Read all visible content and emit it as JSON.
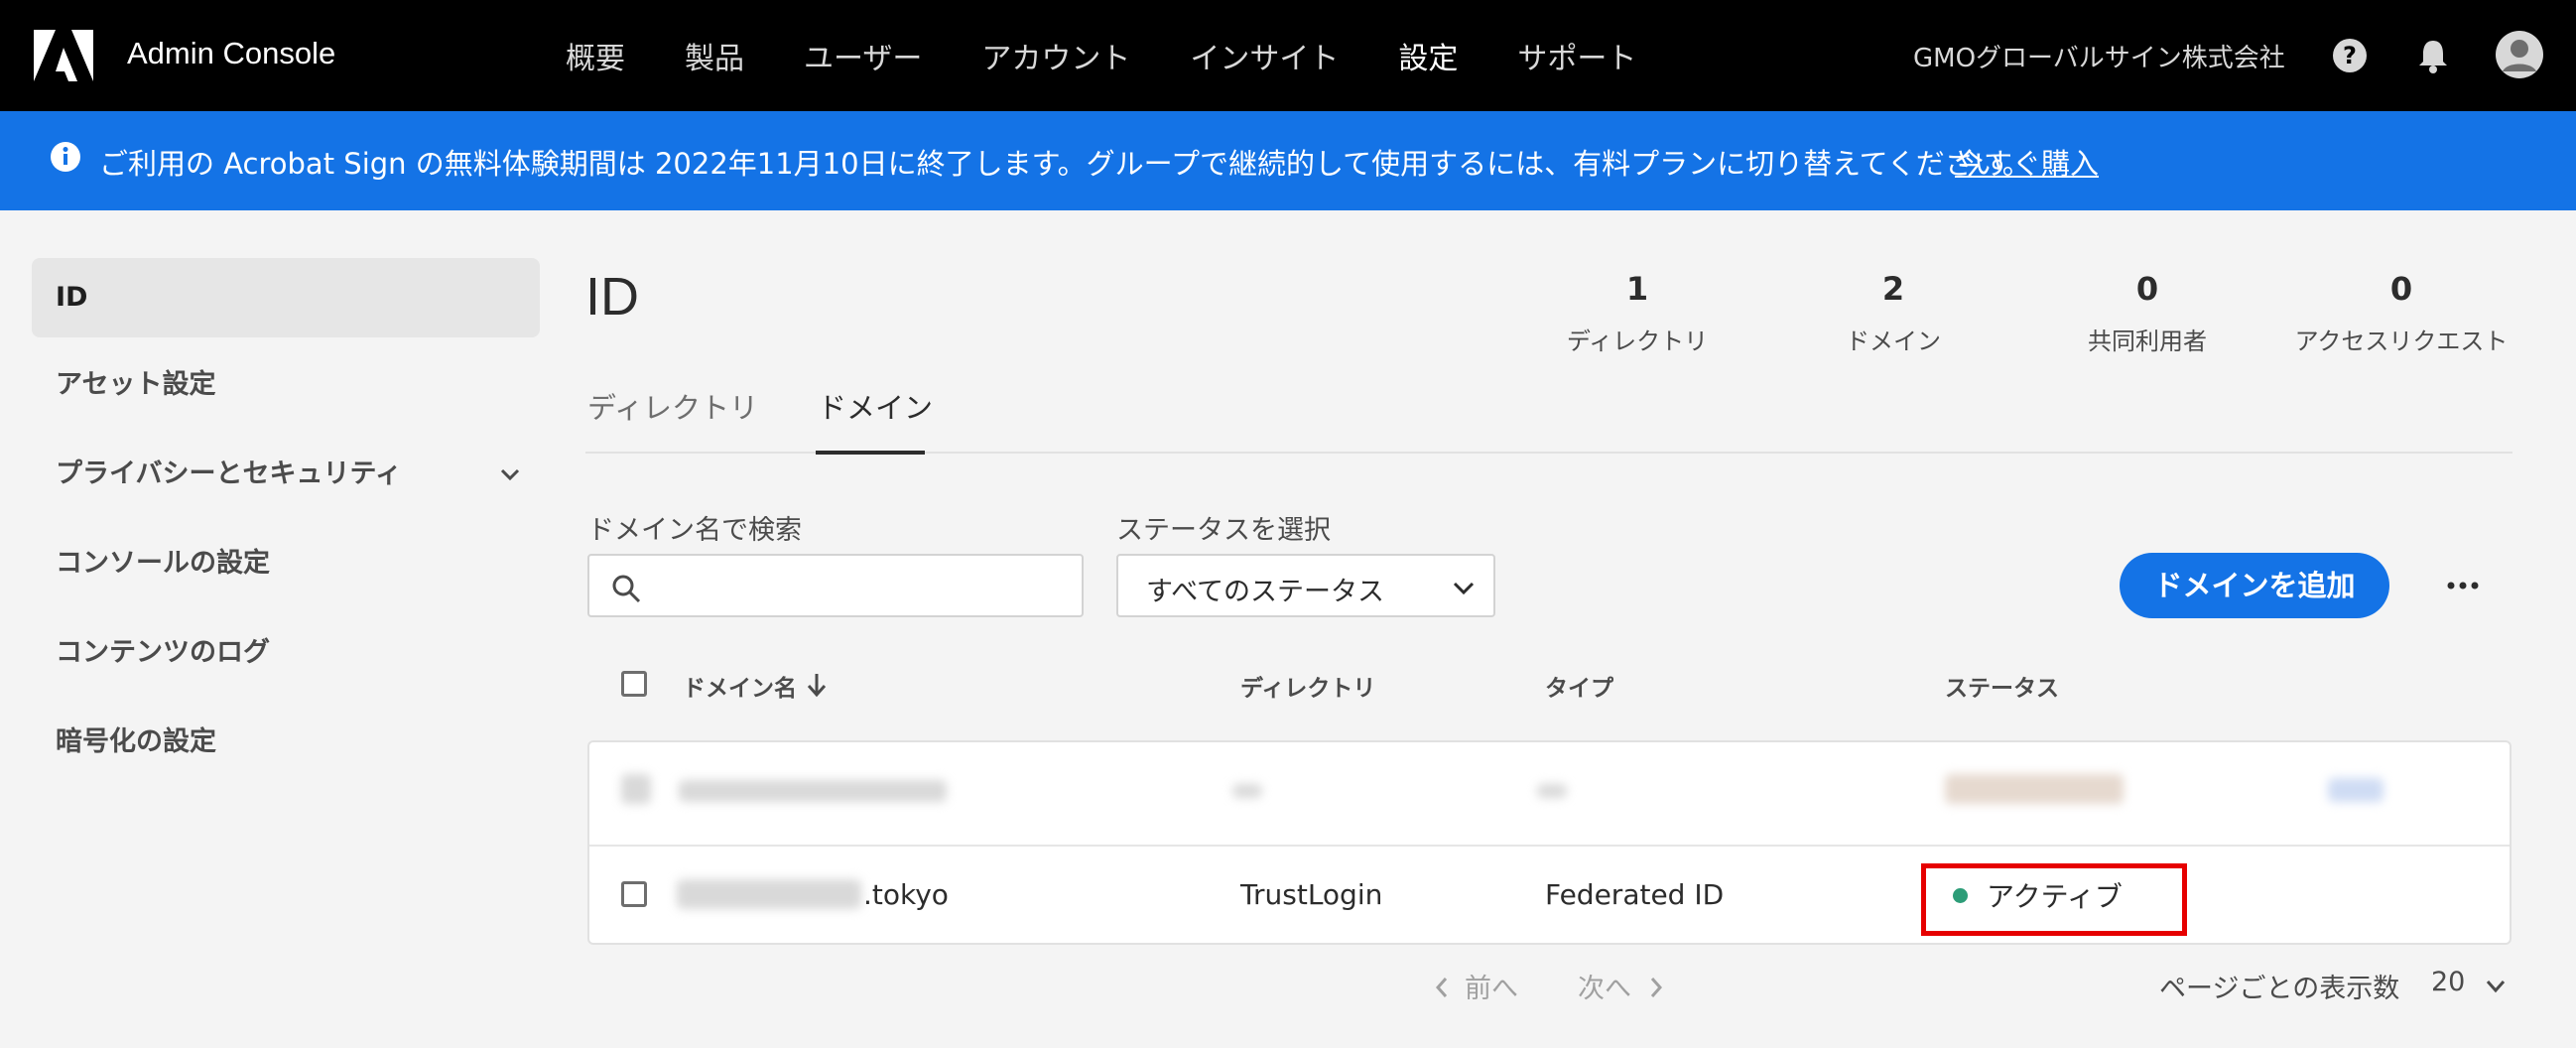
{
  "app": {
    "title": "Admin Console",
    "org": "GMOグローバルサイン株式会社"
  },
  "nav": {
    "items": [
      "概要",
      "製品",
      "ユーザー",
      "アカウント",
      "インサイト",
      "設定",
      "サポート"
    ],
    "active_index": 5
  },
  "banner": {
    "text": "ご利用の Acrobat Sign の無料体験期間は 2022年11月10日に終了します。グループで継続的して使用するには、有料プランに切り替えてください。",
    "link": "今すぐ購入"
  },
  "sidebar": {
    "items": [
      {
        "label": "ID",
        "active": true
      },
      {
        "label": "アセット設定"
      },
      {
        "label": "プライバシーとセキュリティ",
        "expandable": true
      },
      {
        "label": "コンソールの設定"
      },
      {
        "label": "コンテンツのログ"
      },
      {
        "label": "暗号化の設定"
      }
    ]
  },
  "main": {
    "title": "ID",
    "stats": [
      {
        "value": "1",
        "label": "ディレクトリ"
      },
      {
        "value": "2",
        "label": "ドメイン"
      },
      {
        "value": "0",
        "label": "共同利用者"
      },
      {
        "value": "0",
        "label": "アクセスリクエスト"
      }
    ],
    "tabs": [
      "ディレクトリ",
      "ドメイン"
    ],
    "active_tab": 1
  },
  "filters": {
    "search_label": "ドメイン名で検索",
    "search_value": "",
    "status_label": "ステータスを選択",
    "status_value": "すべてのステータス"
  },
  "actions": {
    "add_domain": "ドメインを追加"
  },
  "table": {
    "headers": [
      "ドメイン名",
      "ディレクトリ",
      "タイプ",
      "ステータス"
    ],
    "rows": [
      {
        "domain": "",
        "directory": "",
        "type": "",
        "status": "",
        "redacted": true
      },
      {
        "domain": ".tokyo",
        "directory": "TrustLogin",
        "type": "Federated ID",
        "status": "アクティブ"
      }
    ]
  },
  "pagination": {
    "prev": "前へ",
    "next": "次へ",
    "per_page_label": "ページごとの表示数",
    "per_page": "20"
  },
  "colors": {
    "accent": "#1473e6",
    "active_status": "#2d9d78",
    "highlight": "#e60000"
  }
}
